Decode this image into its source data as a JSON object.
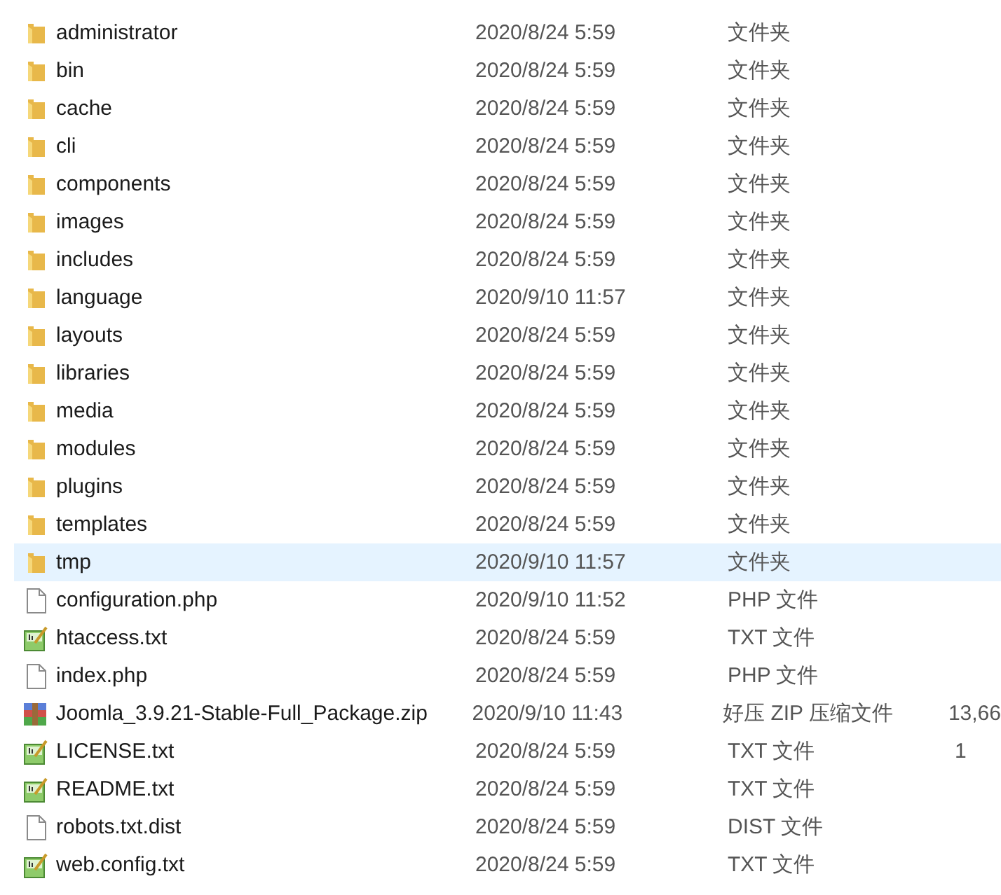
{
  "files": [
    {
      "kind": "folder",
      "name": "administrator",
      "modified": "2020/8/24 5:59",
      "type": "文件夹",
      "selected": false
    },
    {
      "kind": "folder",
      "name": "bin",
      "modified": "2020/8/24 5:59",
      "type": "文件夹",
      "selected": false
    },
    {
      "kind": "folder",
      "name": "cache",
      "modified": "2020/8/24 5:59",
      "type": "文件夹",
      "selected": false
    },
    {
      "kind": "folder",
      "name": "cli",
      "modified": "2020/8/24 5:59",
      "type": "文件夹",
      "selected": false
    },
    {
      "kind": "folder",
      "name": "components",
      "modified": "2020/8/24 5:59",
      "type": "文件夹",
      "selected": false
    },
    {
      "kind": "folder",
      "name": "images",
      "modified": "2020/8/24 5:59",
      "type": "文件夹",
      "selected": false
    },
    {
      "kind": "folder",
      "name": "includes",
      "modified": "2020/8/24 5:59",
      "type": "文件夹",
      "selected": false
    },
    {
      "kind": "folder",
      "name": "language",
      "modified": "2020/9/10 11:57",
      "type": "文件夹",
      "selected": false
    },
    {
      "kind": "folder",
      "name": "layouts",
      "modified": "2020/8/24 5:59",
      "type": "文件夹",
      "selected": false
    },
    {
      "kind": "folder",
      "name": "libraries",
      "modified": "2020/8/24 5:59",
      "type": "文件夹",
      "selected": false
    },
    {
      "kind": "folder",
      "name": "media",
      "modified": "2020/8/24 5:59",
      "type": "文件夹",
      "selected": false
    },
    {
      "kind": "folder",
      "name": "modules",
      "modified": "2020/8/24 5:59",
      "type": "文件夹",
      "selected": false
    },
    {
      "kind": "folder",
      "name": "plugins",
      "modified": "2020/8/24 5:59",
      "type": "文件夹",
      "selected": false
    },
    {
      "kind": "folder",
      "name": "templates",
      "modified": "2020/8/24 5:59",
      "type": "文件夹",
      "selected": false
    },
    {
      "kind": "folder",
      "name": "tmp",
      "modified": "2020/9/10 11:57",
      "type": "文件夹",
      "selected": true
    },
    {
      "kind": "file",
      "name": "configuration.php",
      "modified": "2020/9/10 11:52",
      "type": "PHP 文件",
      "selected": false
    },
    {
      "kind": "text",
      "name": "htaccess.txt",
      "modified": "2020/8/24 5:59",
      "type": "TXT 文件",
      "selected": false
    },
    {
      "kind": "file",
      "name": "index.php",
      "modified": "2020/8/24 5:59",
      "type": "PHP 文件",
      "selected": false
    },
    {
      "kind": "archive",
      "name": "Joomla_3.9.21-Stable-Full_Package.zip",
      "modified": "2020/9/10 11:43",
      "type": "好压 ZIP 压缩文件",
      "size": "13,66",
      "selected": false
    },
    {
      "kind": "text",
      "name": "LICENSE.txt",
      "modified": "2020/8/24 5:59",
      "type": "TXT 文件",
      "size": "1",
      "selected": false
    },
    {
      "kind": "text",
      "name": "README.txt",
      "modified": "2020/8/24 5:59",
      "type": "TXT 文件",
      "selected": false
    },
    {
      "kind": "file",
      "name": "robots.txt.dist",
      "modified": "2020/8/24 5:59",
      "type": "DIST 文件",
      "selected": false
    },
    {
      "kind": "text",
      "name": "web.config.txt",
      "modified": "2020/8/24 5:59",
      "type": "TXT 文件",
      "selected": false
    }
  ]
}
